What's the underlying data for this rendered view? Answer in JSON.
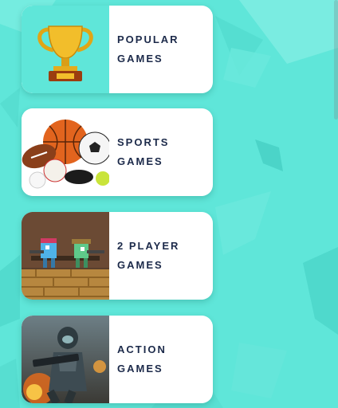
{
  "colors": {
    "background": "#5fe6d9",
    "card": "#ffffff",
    "text": "#1c2a4a",
    "popular_thumb": "#5fe6d9"
  },
  "categories": [
    {
      "line1": "POPULAR",
      "line2": "GAMES",
      "icon": "trophy-icon"
    },
    {
      "line1": "SPORTS",
      "line2": "GAMES",
      "icon": "sports-balls-icon"
    },
    {
      "line1": "2 PLAYER",
      "line2": "GAMES",
      "icon": "two-player-icon"
    },
    {
      "line1": "ACTION",
      "line2": "GAMES",
      "icon": "action-soldier-icon"
    }
  ]
}
